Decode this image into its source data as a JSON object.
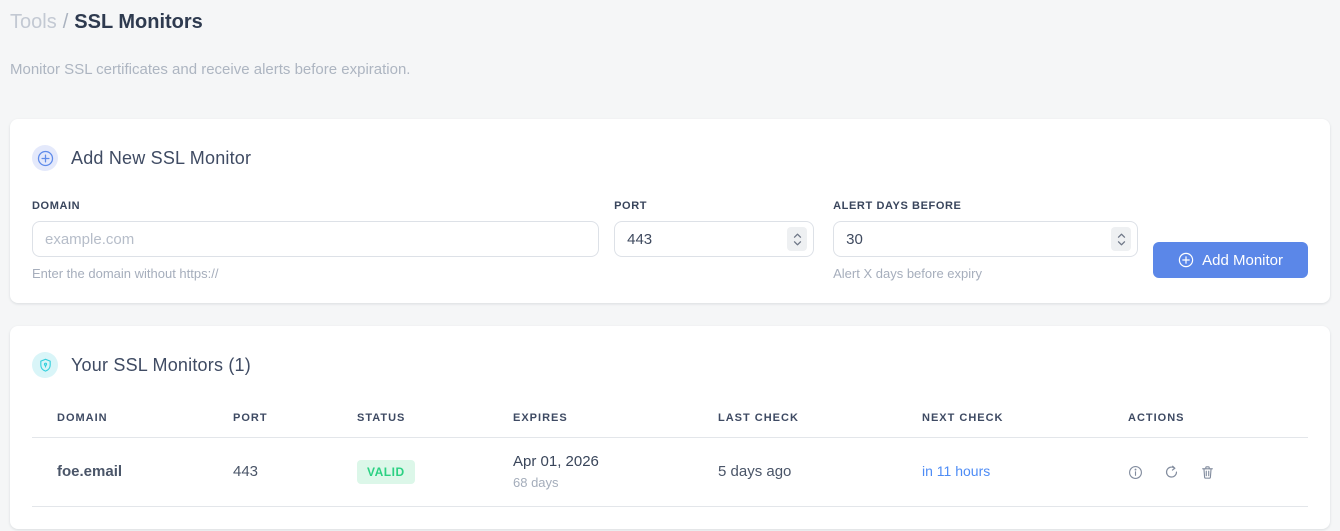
{
  "breadcrumb": {
    "section": "Tools",
    "separator": "/",
    "page": "SSL Monitors"
  },
  "subtitle": "Monitor SSL certificates and receive alerts before expiration.",
  "add_card": {
    "title": "Add New SSL Monitor",
    "fields": {
      "domain": {
        "label": "DOMAIN",
        "placeholder": "example.com",
        "hint": "Enter the domain without https://"
      },
      "port": {
        "label": "PORT",
        "value": "443"
      },
      "alert_days": {
        "label": "ALERT DAYS BEFORE",
        "value": "30",
        "hint": "Alert X days before expiry"
      }
    },
    "submit_label": "Add Monitor"
  },
  "monitors_card": {
    "title": "Your SSL Monitors (1)",
    "table": {
      "headers": [
        "DOMAIN",
        "PORT",
        "STATUS",
        "EXPIRES",
        "LAST CHECK",
        "NEXT CHECK",
        "ACTIONS"
      ],
      "rows": [
        {
          "domain": "foe.email",
          "port": "443",
          "status": "VALID",
          "expires_date": "Apr 01, 2026",
          "expires_days": "68 days",
          "last_check": "5 days ago",
          "next_check": "in 11 hours"
        }
      ]
    }
  },
  "icons": {
    "add_card_badge": "plus-circle-icon",
    "monitors_card_badge": "shield-icon",
    "submit_button": "plus-circle-icon",
    "row_actions": [
      "info-icon",
      "refresh-icon",
      "trash-icon"
    ]
  },
  "colors": {
    "primary_button": "#5b87e8",
    "badge_blue_bg": "#e4e9fb",
    "badge_cyan_bg": "#d9f5f8",
    "shield_icon": "#35d0dd",
    "valid_badge_bg": "#dcf7e9",
    "valid_badge_text": "#2bd183",
    "next_check_text": "#4e8cf5",
    "page_background": "#f5f6f7"
  }
}
